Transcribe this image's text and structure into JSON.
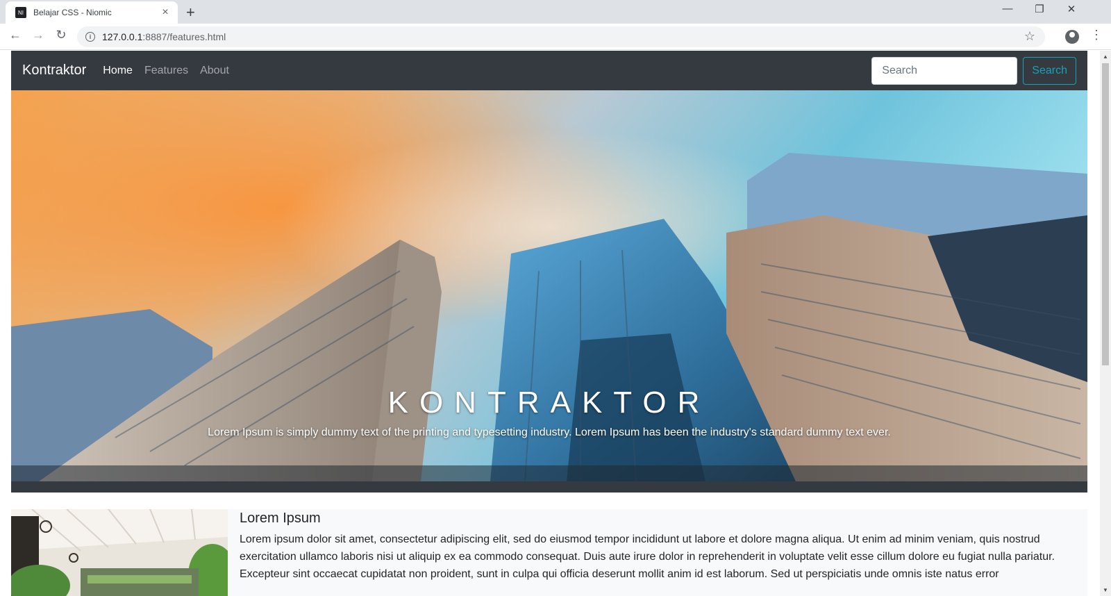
{
  "browser": {
    "tab_title": "Belajar CSS - Niomic",
    "favicon_text": "NI",
    "tab_close": "×",
    "new_tab": "+",
    "url_host": "127.0.0.1",
    "url_path": ":8887/features.html",
    "minimize": "—",
    "restore": "❐",
    "close": "✕"
  },
  "navbar": {
    "brand": "Kontraktor",
    "links": [
      {
        "label": "Home",
        "active": true
      },
      {
        "label": "Features",
        "active": false
      },
      {
        "label": "About",
        "active": false
      }
    ],
    "search_placeholder": "Search",
    "search_button": "Search",
    "background": "#343a40",
    "accent": "#17a2b8"
  },
  "hero": {
    "title": "KONTRAKTOR",
    "subtitle": "Lorem Ipsum is simply dummy text of the printing and typesetting industry. Lorem Ipsum has been the industry's standard dummy text ever."
  },
  "media": {
    "heading": "Lorem Ipsum",
    "text": "Lorem ipsum dolor sit amet, consectetur adipiscing elit, sed do eiusmod tempor incididunt ut labore et dolore magna aliqua. Ut enim ad minim veniam, quis nostrud exercitation ullamco laboris nisi ut aliquip ex ea commodo consequat. Duis aute irure dolor in reprehenderit in voluptate velit esse cillum dolore eu fugiat nulla pariatur. Excepteur sint occaecat cupidatat non proident, sunt in culpa qui officia deserunt mollit anim id est laborum. Sed ut perspiciatis unde omnis iste natus error"
  }
}
